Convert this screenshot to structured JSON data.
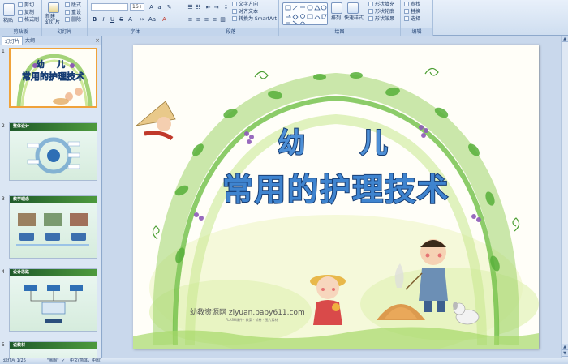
{
  "ribbon": {
    "clipboard": {
      "paste": "粘贴",
      "cut": "剪切",
      "copy": "复制",
      "format_painter": "格式刷",
      "label": "剪贴板"
    },
    "slides": {
      "new_slide": "新建\n幻灯片",
      "layout": "版式",
      "reset": "重设",
      "delete": "删除",
      "label": "幻灯片"
    },
    "font": {
      "font_name": "",
      "font_size": "16+",
      "bold": "B",
      "italic": "I",
      "underline": "U",
      "strike": "S",
      "shadow": "A",
      "label": "字体"
    },
    "paragraph": {
      "text_direction": "文字方向",
      "align_text": "对齐文本",
      "smartart": "转换为 SmartArt",
      "label": "段落"
    },
    "drawing": {
      "arrange": "排列",
      "quick_styles": "快速样式",
      "shape_fill": "形状填充",
      "shape_outline": "形状轮廓",
      "shape_effects": "形状效果",
      "label": "绘图"
    },
    "editing": {
      "find": "查找",
      "replace": "替换",
      "select": "选择",
      "label": "编辑"
    }
  },
  "panel": {
    "tabs": [
      "幻灯片",
      "大纲"
    ],
    "close": "×",
    "thumbnails": [
      {
        "num": "1",
        "title": "",
        "line1": "幼 儿",
        "line2": "常用的护理技术"
      },
      {
        "num": "2",
        "title": "整体设计",
        "line1": "",
        "line2": ""
      },
      {
        "num": "3",
        "title": "教学理念",
        "line1": "",
        "line2": ""
      },
      {
        "num": "4",
        "title": "设计思路",
        "line1": "",
        "line2": ""
      },
      {
        "num": "5",
        "title": "说教材",
        "line1": "",
        "line2": ""
      }
    ]
  },
  "slide": {
    "title_line1": "幼 儿",
    "title_line2": "常用的护理技术",
    "watermark": "幼教资源网 ziyuan.baby611.com",
    "watermark_sub": "FLASH课件 · 教案 · 试卷 · 图片素材"
  },
  "status": {
    "slide_info": "幻灯片 1/26",
    "theme": "\"画图\"",
    "language": "中文(简体，中国)"
  },
  "colors": {
    "title_fill": "#3f84cf",
    "title_stroke": "#173d73",
    "thumb_header": "#2d6a30",
    "selected_border": "#f0a23a"
  }
}
